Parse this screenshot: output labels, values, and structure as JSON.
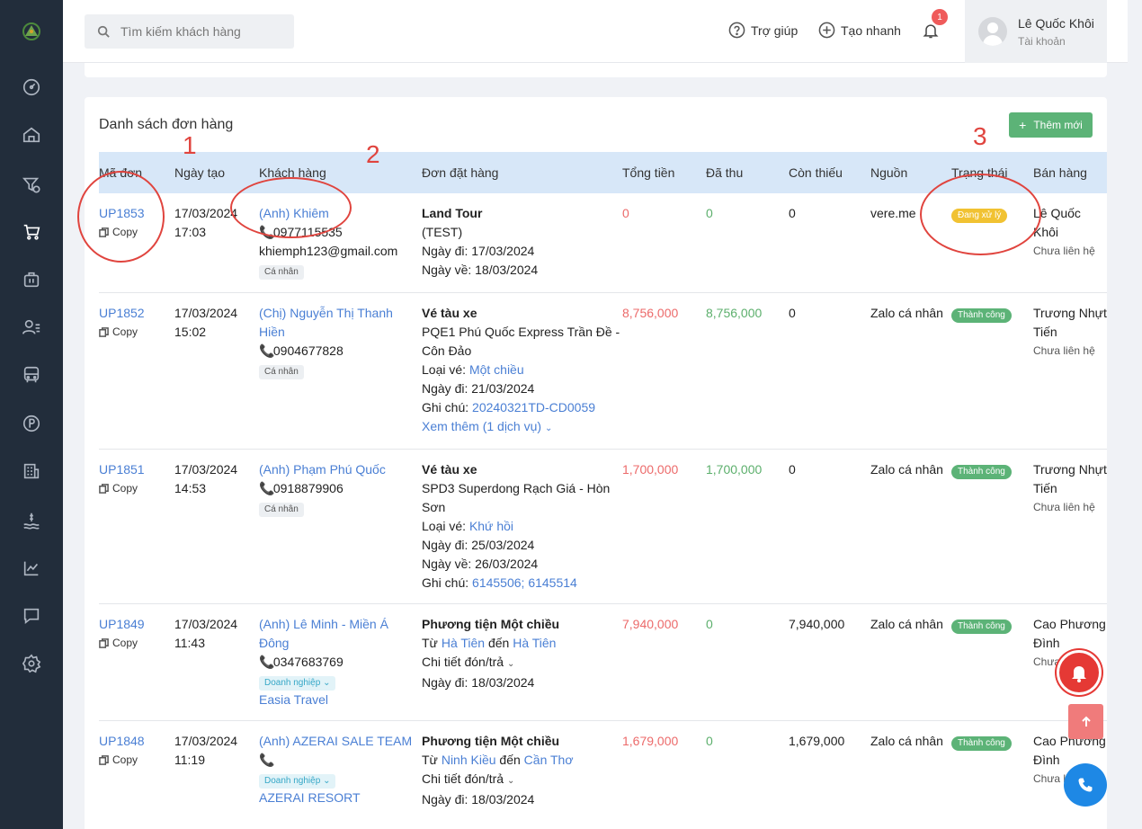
{
  "search": {
    "placeholder": "Tìm kiếm khách hàng"
  },
  "topbar": {
    "help_label": "Trợ giúp",
    "quick_create_label": "Tạo nhanh",
    "notification_count": "1",
    "account_name": "Lê Quốc Khôi",
    "account_sub": "Tài khoản"
  },
  "sidebar": {
    "items": [
      {
        "icon": "dashboard-icon"
      },
      {
        "icon": "home-icon"
      },
      {
        "icon": "filter-money-icon"
      },
      {
        "icon": "cart-icon"
      },
      {
        "icon": "briefcase-icon"
      },
      {
        "icon": "users-list-icon"
      },
      {
        "icon": "bus-icon"
      },
      {
        "icon": "parking-icon"
      },
      {
        "icon": "building-icon"
      },
      {
        "icon": "water-money-icon"
      },
      {
        "icon": "chart-line-icon"
      },
      {
        "icon": "chat-icon"
      },
      {
        "icon": "settings-icon"
      }
    ]
  },
  "orders": {
    "title": "Danh sách đơn hàng",
    "add_label": "Thêm mới",
    "columns": [
      "Mã đơn",
      "Ngày tạo",
      "Khách hàng",
      "Đơn đặt hàng",
      "Tổng tiền",
      "Đã thu",
      "Còn thiếu",
      "Nguồn",
      "Trạng thái",
      "Bán hàng"
    ],
    "copy_label": "Copy",
    "rows": [
      {
        "code": "UP1853",
        "date": "17/03/2024",
        "time": "17:03",
        "customer": "(Anh) Khiêm",
        "phone": "0977115535",
        "email": "khiemph123@gmail.com",
        "customer_type": "Cá nhân",
        "order_title": "Land Tour",
        "order_lines": [
          "(TEST)",
          "Ngày đi: 17/03/2024",
          "Ngày về: 18/03/2024"
        ],
        "total": "0",
        "paid": "0",
        "remaining": "0",
        "source": "vere.me",
        "status": "Đang xử lý",
        "seller": "Lê Quốc Khôi",
        "seller_sub": "Chưa liên hệ"
      },
      {
        "code": "UP1852",
        "date": "17/03/2024",
        "time": "15:02",
        "customer": "(Chị) Nguyễn Thị Thanh Hiền",
        "phone": "0904677828",
        "customer_type": "Cá nhân",
        "order_title": "Vé tàu xe",
        "order_line1": "PQE1 Phú Quốc Express Trần Đề - Côn Đảo",
        "ticket_label": "Loại vé:",
        "ticket_value": "Một chiều",
        "depart": "Ngày đi: 21/03/2024",
        "note_label": "Ghi chú:",
        "note_value": "20240321TD-CD0059",
        "more": "Xem thêm (1 dịch vụ)",
        "total": "8,756,000",
        "paid": "8,756,000",
        "remaining": "0",
        "source": "Zalo cá nhân",
        "status": "Thành công",
        "seller": "Trương Nhựt Tiến",
        "seller_sub": "Chưa liên hệ"
      },
      {
        "code": "UP1851",
        "date": "17/03/2024",
        "time": "14:53",
        "customer": "(Anh) Phạm Phú Quốc",
        "phone": "0918879906",
        "customer_type": "Cá nhân",
        "order_title": "Vé tàu xe",
        "order_line1": "SPD3 Superdong Rạch Giá - Hòn Sơn",
        "ticket_label": "Loại vé:",
        "ticket_value": "Khứ hồi",
        "depart": "Ngày đi: 25/03/2024",
        "return": "Ngày về: 26/03/2024",
        "note_label": "Ghi chú:",
        "note_value": "6145506; 6145514",
        "total": "1,700,000",
        "paid": "1,700,000",
        "remaining": "0",
        "source": "Zalo cá nhân",
        "status": "Thành công",
        "seller": "Trương Nhựt Tiến",
        "seller_sub": "Chưa liên hệ"
      },
      {
        "code": "UP1849",
        "date": "17/03/2024",
        "time": "11:43",
        "customer": "(Anh) Lê Minh - Miền Á Đông",
        "phone": "0347683769",
        "customer_type": "Doanh nghiệp",
        "company": "Easia Travel",
        "order_title": "Phương tiện Một chiều",
        "from_label": "Từ",
        "from": "Hà Tiên",
        "to_label": "đến",
        "to": "Hà Tiên",
        "detail": "Chi tiết đón/trả",
        "depart": "Ngày đi: 18/03/2024",
        "total": "7,940,000",
        "paid": "0",
        "remaining": "7,940,000",
        "source": "Zalo cá nhân",
        "status": "Thành công",
        "seller": "Cao Phương Đình",
        "seller_sub": "Chưa liên hệ"
      },
      {
        "code": "UP1848",
        "date": "17/03/2024",
        "time": "11:19",
        "customer": "(Anh) AZERAI SALE TEAM",
        "phone": "",
        "customer_type": "Doanh nghiệp",
        "company": "AZERAI RESORT",
        "order_title": "Phương tiện Một chiều",
        "from_label": "Từ",
        "from": "Ninh Kiều",
        "to_label": "đến",
        "to": "Cần Thơ",
        "detail": "Chi tiết đón/trả",
        "depart": "Ngày đi: 18/03/2024",
        "total": "1,679,000",
        "paid": "0",
        "remaining": "1,679,000",
        "source": "Zalo cá nhân",
        "status": "Thành công",
        "seller": "Cao Phương Đình",
        "seller_sub": "Chưa liên hệ"
      }
    ]
  },
  "annotations": {
    "one": "1",
    "two": "2",
    "three": "3"
  },
  "colors": {
    "sidebar": "#222d3b",
    "accent_blue": "#4a7fd4",
    "success": "#5cb377",
    "pending": "#f1c232",
    "danger": "#ec6a6a"
  }
}
